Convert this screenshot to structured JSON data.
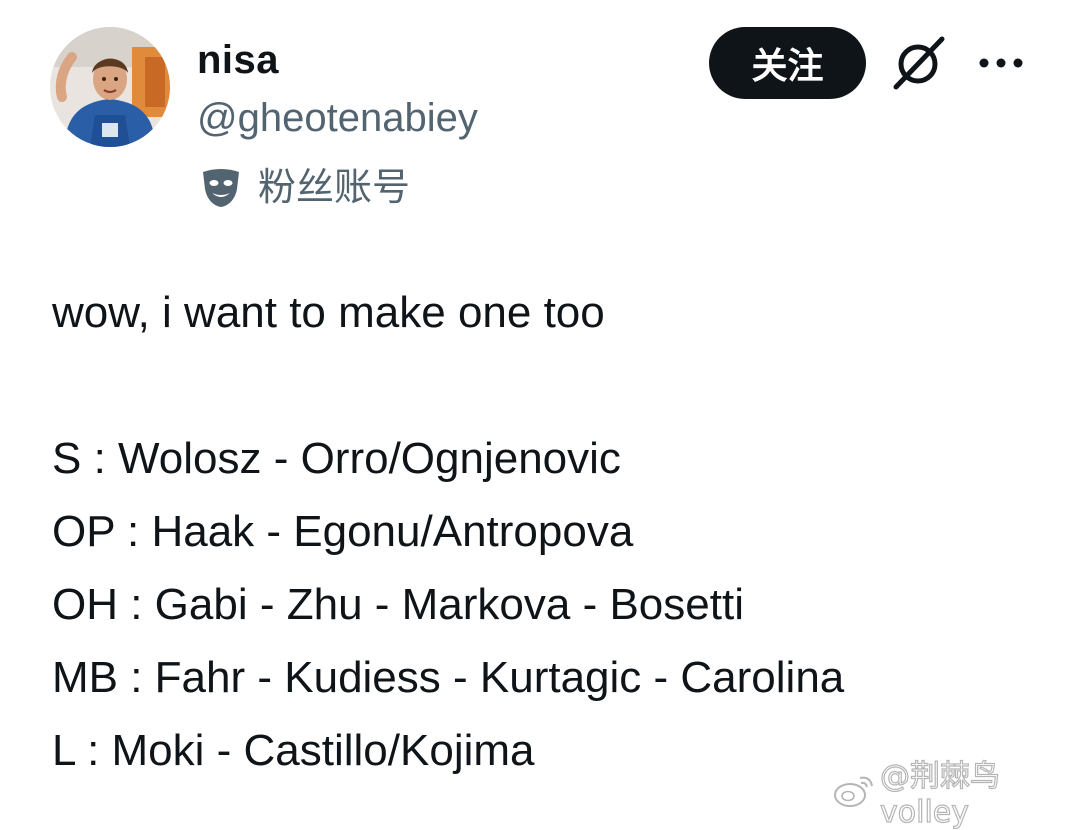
{
  "user": {
    "display_name": "nisa",
    "handle": "@gheotenabiey",
    "fan_label": "粉丝账号",
    "avatar": "avatar-photo",
    "fan_icon": "mask-icon"
  },
  "actions": {
    "follow_label": "关注",
    "grok_icon": "grok-icon",
    "more_icon": "more-icon"
  },
  "tweet": {
    "lines": [
      "wow, i want to make one too",
      "",
      "S : Wolosz - Orro/Ognjenovic",
      "OP : Haak - Egonu/Antropova",
      "OH : Gabi - Zhu - Markova - Bosetti",
      "MB : Fahr - Kudiess - Kurtagic - Carolina",
      "L : Moki - Castillo/Kojima"
    ]
  },
  "watermark": {
    "text": "@荆棘鸟volley",
    "logo": "weibo-logo"
  },
  "colors": {
    "text_primary": "#0f1419",
    "text_secondary": "#536471",
    "button_bg": "#0f1419",
    "button_text": "#ffffff"
  }
}
